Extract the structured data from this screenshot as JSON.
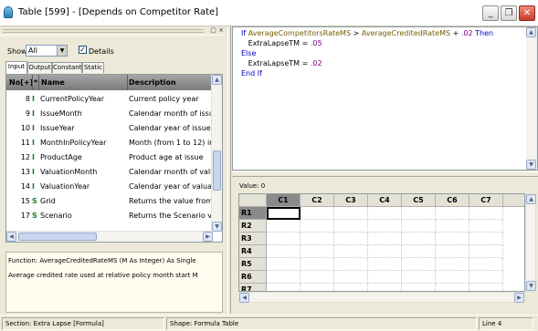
{
  "window": {
    "title": "Table [599] - [Depends on Competitor Rate]",
    "minimize": "_",
    "restore": "❐",
    "close": "✕"
  },
  "pane_buttons": "▢ ×",
  "show": {
    "label": "Show",
    "value": "All"
  },
  "details": {
    "label": "Details",
    "checked": true,
    "mark": "✓"
  },
  "tabs": [
    "Input",
    "Output",
    "Constant",
    "Static"
  ],
  "active_tab": "Input",
  "grid": {
    "headers": {
      "no": "No[+]",
      "star": "*",
      "name": "Name",
      "description": "Description"
    },
    "rows": [
      {
        "no": "8",
        "type": "I",
        "name": "CurrentPolicyYear",
        "description": "Current policy year"
      },
      {
        "no": "9",
        "type": "I",
        "name": "IssueMonth",
        "description": "Calendar month of issue"
      },
      {
        "no": "10",
        "type": "I",
        "name": "IssueYear",
        "description": "Calendar year of issue"
      },
      {
        "no": "11",
        "type": "I",
        "name": "MonthInPolicyYear",
        "description": "Month (from 1 to 12) in pol"
      },
      {
        "no": "12",
        "type": "I",
        "name": "ProductAge",
        "description": "Product age at issue"
      },
      {
        "no": "13",
        "type": "I",
        "name": "ValuationMonth",
        "description": "Calendar month of valuatio"
      },
      {
        "no": "14",
        "type": "I",
        "name": "ValuationYear",
        "description": "Calendar year of valuation"
      },
      {
        "no": "15",
        "type": "S",
        "name": "Grid",
        "description": "Returns the value from the"
      },
      {
        "no": "17",
        "type": "S",
        "name": "Scenario",
        "description": "Returns the Scenario value"
      }
    ]
  },
  "function_info": {
    "signature": "Function: AverageCreditedRateMS (M As Integer) As Single",
    "description": "Average credited rate used at relative policy month start M"
  },
  "code": {
    "line1": {
      "kw1": "If ",
      "var1": "AverageCompetitorsRateMS",
      "op": " > ",
      "var2": "AverageCreditedRateMS",
      "plus": " + ",
      "num": ".02",
      "kw2": " Then"
    },
    "line2": {
      "text": "   ExtraLapseTM = ",
      "num": ".05"
    },
    "line3": {
      "kw": "Else"
    },
    "line4": {
      "text": "   ExtraLapseTM = ",
      "num": ".02"
    },
    "line5": {
      "kw": "End If"
    }
  },
  "value_label": "Value: 0",
  "table": {
    "columns": [
      "C1",
      "C2",
      "C3",
      "C4",
      "C5",
      "C6",
      "C7"
    ],
    "rows": [
      "R1",
      "R2",
      "R3",
      "R4",
      "R5",
      "R6",
      "R7"
    ],
    "selected_cell": "R1C1"
  },
  "status": {
    "section": "Section: Extra Lapse [Formula]",
    "shape": "Shape: Formula Table",
    "line": "Line 4"
  },
  "colors": {
    "keyword": "#0000c0",
    "variable": "#7a5c00",
    "number": "#800080",
    "type_letter": "#1a7a2a"
  }
}
